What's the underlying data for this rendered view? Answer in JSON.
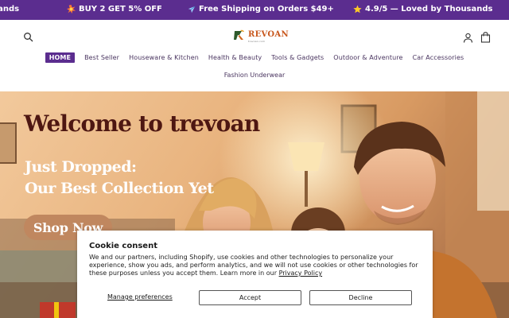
{
  "announcement": {
    "items": [
      {
        "text": "usands"
      },
      {
        "text": "BUY 2 GET 5% OFF",
        "icon": "burst-icon"
      },
      {
        "text": "Free Shipping on Orders $49+",
        "icon": "airplane-icon"
      },
      {
        "text": "4.9/5 — Loved by Thousands",
        "icon": "star-icon"
      }
    ],
    "background": "#5b2d8f"
  },
  "header": {
    "logo_text": "REVOAN",
    "logo_tagline": "trevoan.com",
    "nav": [
      {
        "label": "HOME",
        "active": true
      },
      {
        "label": "Best Seller"
      },
      {
        "label": "Houseware & Kitchen"
      },
      {
        "label": "Health & Beauty"
      },
      {
        "label": "Tools & Gadgets"
      },
      {
        "label": "Outdoor & Adventure"
      },
      {
        "label": "Car Accessories"
      },
      {
        "label": "Fashion Underwear"
      }
    ]
  },
  "hero": {
    "title": "Welcome to trevoan",
    "subtitle_line1": "Just Dropped:",
    "subtitle_line2": "Our Best Collection Yet",
    "cta": "Shop Now"
  },
  "cookie": {
    "title": "Cookie consent",
    "body": "We and our partners, including Shopify, use cookies and other technologies to personalize your experience, show you ads, and perform analytics, and we will not use cookies or other technologies for these purposes unless you accept them. Learn more in our ",
    "policy_link": "Privacy Policy",
    "manage": "Manage preferences",
    "accept": "Accept",
    "decline": "Decline"
  },
  "colors": {
    "brand_purple": "#5b2d8f",
    "hero_title": "#4e1712",
    "cta_bg": "#c0875f",
    "logo_orange": "#c8571d"
  }
}
